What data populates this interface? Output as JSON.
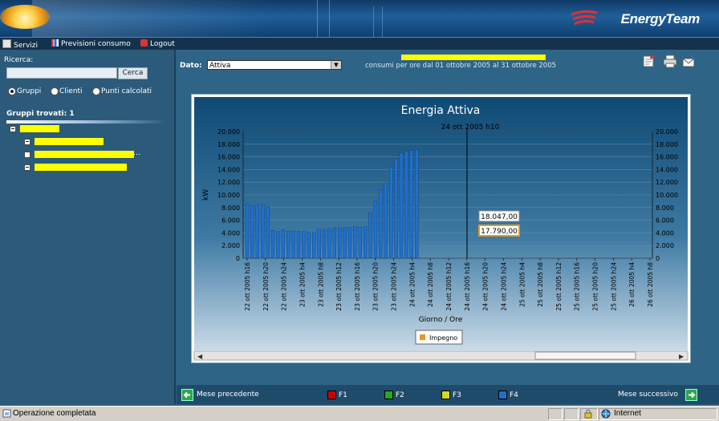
{
  "header": {
    "logo_text": "EnergyTeam"
  },
  "menu": {
    "items": [
      {
        "label": "Servizi",
        "icon": "services-icon"
      },
      {
        "label": "Previsioni consumo",
        "icon": "forecast-chart-icon"
      },
      {
        "label": "Logout",
        "icon": "logout-icon"
      }
    ]
  },
  "sidebar": {
    "search_label": "Ricerca:",
    "search_value": "",
    "search_button": "Cerca",
    "radio_options": [
      {
        "label": "Gruppi",
        "selected": true
      },
      {
        "label": "Clienti",
        "selected": false
      },
      {
        "label": "Punti calcolati",
        "selected": false
      }
    ],
    "groups_found_label": "Gruppi trovati: 1"
  },
  "toolbar": {
    "dato_label": "Dato:",
    "dato_value": "Attiva",
    "range_text": "consumi per ore dal 01 ottobre 2005 al 31 ottobre 2005"
  },
  "chart_data": {
    "type": "bar",
    "title": "Energia Attiva",
    "ylabel": "kW",
    "xlabel": "Giorno / Ore",
    "ylim": [
      0,
      20000
    ],
    "y2lim": [
      0,
      20000
    ],
    "yticks": [
      "0",
      "2.000",
      "4.000",
      "6.000",
      "8.000",
      "10.000",
      "12.000",
      "14.000",
      "16.000",
      "18.000",
      "20.000"
    ],
    "y2ticks": [
      "0",
      "2.000",
      "4.000",
      "6.000",
      "8.000",
      "10.000",
      "12.000",
      "14.000",
      "16.000",
      "18.000",
      "20.000"
    ],
    "xtick_labels": [
      "22 ott 2005 h16",
      "22 ott 2005 h20",
      "22 ott 2005 h24",
      "23 ott 2005 h4",
      "23 ott 2005 h8",
      "23 ott 2005 h12",
      "23 ott 2005 h16",
      "23 ott 2005 h20",
      "23 ott 2005 h24",
      "24 ott 2005 h4",
      "24 ott 2005 h8",
      "24 ott 2005 h12",
      "24 ott 2005 h16",
      "24 ott 2005 h20",
      "24 ott 2005 h24",
      "25 ott 2005 h4",
      "25 ott 2005 h8",
      "25 ott 2005 h12",
      "25 ott 2005 h16",
      "25 ott 2005 h20",
      "25 ott 2005 h24",
      "26 ott 2005 h4",
      "26 ott 2005 h8"
    ],
    "crosshair_label": "24 ott 2005 h10",
    "tooltip_values": [
      "18.047,00",
      "17.790,00"
    ],
    "legend": [
      "Impegno"
    ],
    "series": [
      {
        "name": "F1",
        "color": "#cc0000",
        "values": []
      },
      {
        "name": "F2",
        "color": "#22aa22",
        "values": []
      },
      {
        "name": "F3",
        "color": "#d8d820",
        "values": []
      },
      {
        "name": "F4",
        "color": "#1f6fcc",
        "values": [
          8600,
          8300,
          8400,
          8500,
          8100,
          4400,
          4200,
          4500,
          4300,
          4300,
          4200,
          4200,
          4100,
          4100,
          4600,
          4600,
          4700,
          4800,
          4800,
          4900,
          4900,
          5000,
          4900,
          5000,
          7200,
          9000,
          10800,
          11900,
          14400,
          15700,
          16600,
          16900,
          17000,
          17100
        ]
      },
      {
        "name": "Impegno",
        "color": "#e79a1e",
        "values": []
      }
    ]
  },
  "bottom": {
    "prev_label": "Mese precedente",
    "next_label": "Mese successivo",
    "legend": [
      {
        "label": "F1",
        "color": "#cc0000"
      },
      {
        "label": "F2",
        "color": "#22aa22"
      },
      {
        "label": "F3",
        "color": "#d8d820"
      },
      {
        "label": "F4",
        "color": "#1f6fcc"
      }
    ]
  },
  "statusbar": {
    "text": "Operazione completata",
    "zone": "Internet"
  }
}
